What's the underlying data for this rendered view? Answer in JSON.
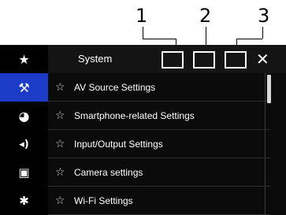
{
  "callouts": [
    "1",
    "2",
    "3"
  ],
  "sidebar": {
    "items": [
      {
        "icon": "star-icon",
        "glyph": "★"
      },
      {
        "icon": "tools-icon",
        "glyph": "⚒"
      },
      {
        "icon": "palette-icon",
        "glyph": "◕"
      },
      {
        "icon": "speaker-icon",
        "glyph": "◂)"
      },
      {
        "icon": "video-frame-icon",
        "glyph": "▣"
      },
      {
        "icon": "bluetooth-icon",
        "glyph": "✱"
      }
    ],
    "active_index": 1
  },
  "header": {
    "title": "System",
    "close_glyph": "✕"
  },
  "menu": {
    "items": [
      {
        "label": "AV Source Settings"
      },
      {
        "label": "Smartphone-related Settings"
      },
      {
        "label": "Input/Output Settings"
      },
      {
        "label": "Camera settings"
      },
      {
        "label": "Wi-Fi Settings"
      }
    ],
    "star_glyph": "☆"
  },
  "colors": {
    "accent": "#1c3cc8",
    "background": "#0b0b0b",
    "text": "#ffffff"
  }
}
